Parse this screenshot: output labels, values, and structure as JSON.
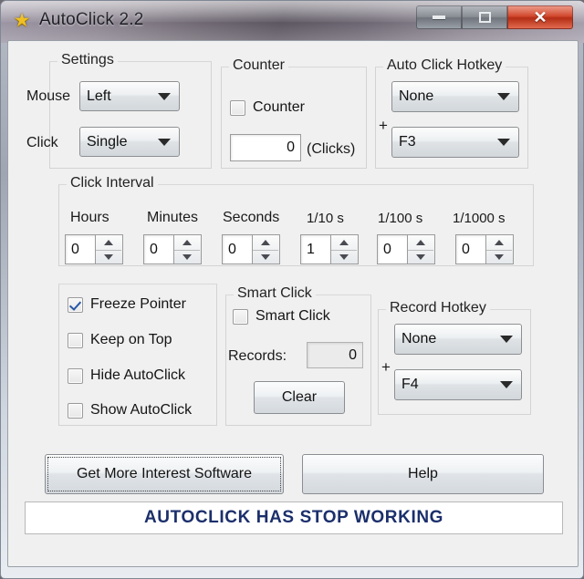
{
  "window": {
    "title": "AutoClick 2.2",
    "icon": "star-icon",
    "controls": {
      "minimize": "minimize-icon",
      "maximize": "maximize-icon",
      "close": "✕"
    },
    "close_color": "#cf3e22"
  },
  "settings": {
    "group_label": "Settings",
    "mouse_label": "Mouse",
    "mouse_value": "Left",
    "click_label": "Click",
    "click_value": "Single"
  },
  "counter": {
    "group_label": "Counter",
    "checkbox_label": "Counter",
    "checkbox_checked": false,
    "value": "0",
    "units_label": "(Clicks)"
  },
  "auto_click_hotkey": {
    "group_label": "Auto Click Hotkey",
    "modifier": "None",
    "plus": "+",
    "key": "F3"
  },
  "click_interval": {
    "group_label": "Click Interval",
    "fields": [
      {
        "label": "Hours",
        "value": "0"
      },
      {
        "label": "Minutes",
        "value": "0"
      },
      {
        "label": "Seconds",
        "value": "0"
      },
      {
        "label": "1/10 s",
        "value": "1"
      },
      {
        "label": "1/100 s",
        "value": "0"
      },
      {
        "label": "1/1000 s",
        "value": "0"
      }
    ]
  },
  "options": {
    "items": [
      {
        "label": "Freeze Pointer",
        "checked": true
      },
      {
        "label": "Keep on Top",
        "checked": false
      },
      {
        "label": "Hide AutoClick",
        "checked": false
      },
      {
        "label": "Show AutoClick",
        "checked": false
      }
    ]
  },
  "smart_click": {
    "group_label": "Smart Click",
    "checkbox_label": "Smart Click",
    "checkbox_checked": false,
    "records_label": "Records:",
    "records_value": "0",
    "clear_label": "Clear"
  },
  "record_hotkey": {
    "group_label": "Record Hotkey",
    "modifier": "None",
    "plus": "+",
    "key": "F4"
  },
  "footer": {
    "more_software_label": "Get More Interest Software",
    "help_label": "Help"
  },
  "status": {
    "text": "AUTOCLICK HAS STOP WORKING",
    "color": "#1b2f6b"
  }
}
